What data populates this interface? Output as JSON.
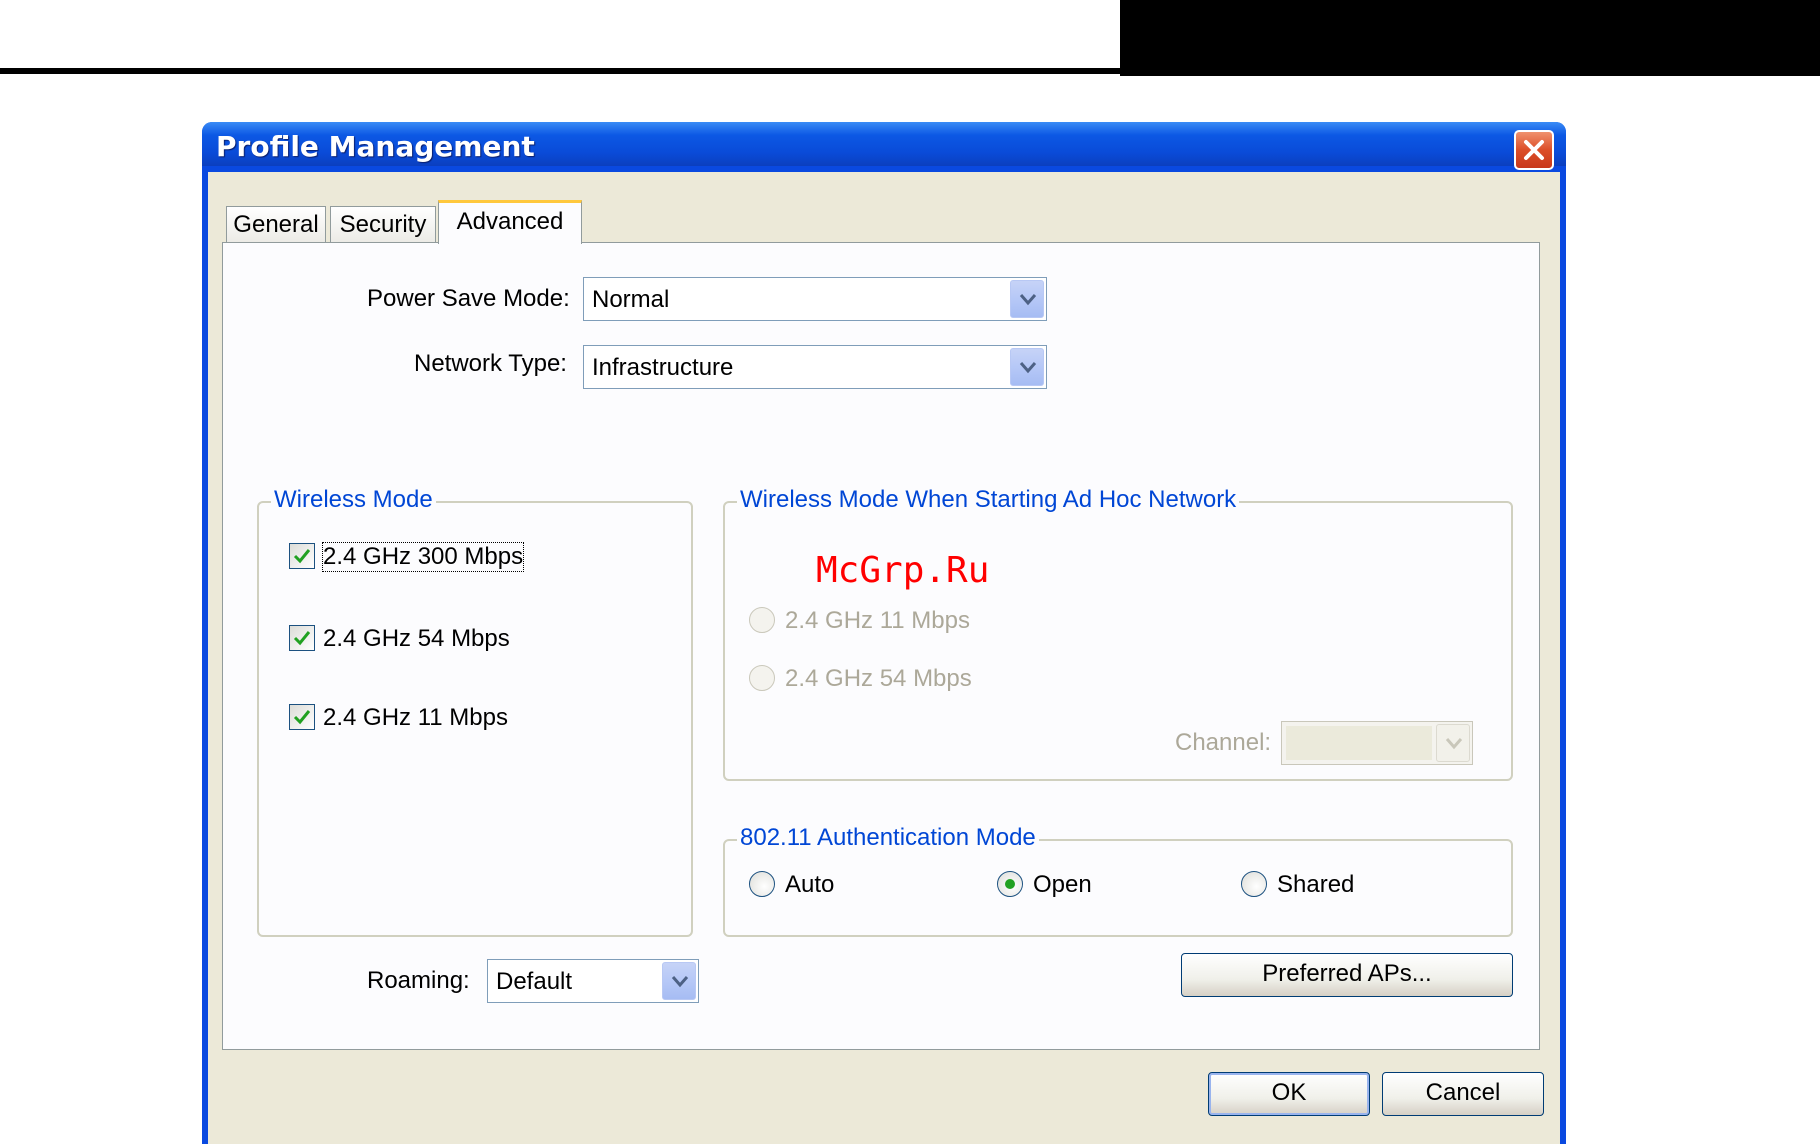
{
  "window": {
    "title": "Profile Management"
  },
  "tabs": [
    {
      "label": "General",
      "active": false
    },
    {
      "label": "Security",
      "active": false
    },
    {
      "label": "Advanced",
      "active": true
    }
  ],
  "power_save": {
    "label": "Power Save Mode:",
    "value": "Normal"
  },
  "network_type": {
    "label": "Network Type:",
    "value": "Infrastructure"
  },
  "wireless_mode": {
    "legend": "Wireless Mode",
    "options": [
      {
        "label": "2.4 GHz 300 Mbps",
        "checked": true
      },
      {
        "label": "2.4 GHz 54 Mbps",
        "checked": true
      },
      {
        "label": "2.4 GHz 11 Mbps",
        "checked": true
      }
    ]
  },
  "adhoc_mode": {
    "legend": "Wireless Mode When Starting Ad Hoc Network",
    "options": [
      {
        "label": "2.4 GHz 11 Mbps",
        "selected": false,
        "disabled": true
      },
      {
        "label": "2.4 GHz 54 Mbps",
        "selected": false,
        "disabled": true
      }
    ],
    "channel_label": "Channel:",
    "channel_value": ""
  },
  "auth_mode": {
    "legend": "802.11 Authentication Mode",
    "options": [
      {
        "label": "Auto",
        "selected": false
      },
      {
        "label": "Open",
        "selected": true
      },
      {
        "label": "Shared",
        "selected": false
      }
    ]
  },
  "roaming": {
    "label": "Roaming:",
    "value": "Default"
  },
  "buttons": {
    "preferred_aps": "Preferred APs...",
    "ok": "OK",
    "cancel": "Cancel"
  },
  "watermark": "McGrp.Ru",
  "colors": {
    "title_bar": "#0a4bd8",
    "group_legend": "#0046d5",
    "check_mark": "#21a121",
    "window_bg": "#ece9d8"
  }
}
